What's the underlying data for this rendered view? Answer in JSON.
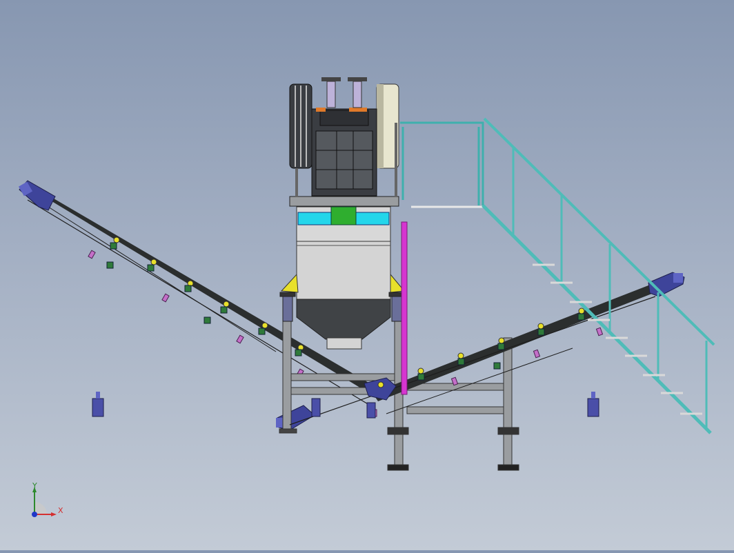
{
  "viewport": {
    "background_top": "#8797b1",
    "background_bottom": "#c3cbd6"
  },
  "triad": {
    "x_label": "X",
    "y_label": "Y",
    "x_color": "#d43030",
    "y_color": "#2d8a2d",
    "z_color": "#2038c8"
  },
  "colors": {
    "belt": "#2b2e2e",
    "frame": "#9a9da0",
    "crusher_body": "#3a3d42",
    "hopper": "#404346",
    "panel_cyan": "#24d6ea",
    "panel_green": "#2fae2f",
    "accent_yellow": "#e8e02a",
    "pipe_magenta": "#d635d0",
    "stair_teal": "#4fbcb8",
    "motor_blue": "#4a4fa8",
    "roller_pink": "#c46fc8",
    "roller_green": "#2f7a3a"
  },
  "icons": {
    "triad": "coordinate-triad-icon"
  }
}
